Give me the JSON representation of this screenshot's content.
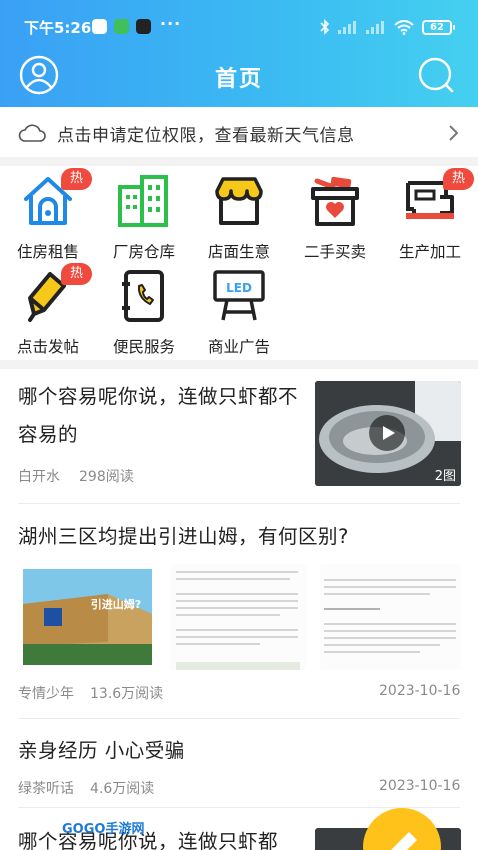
{
  "status": {
    "time": "下午5:26",
    "dots": "···",
    "battery": "62"
  },
  "nav": {
    "title": "首页",
    "left_icon": "user-icon",
    "right_icon": "search-icon"
  },
  "weather": {
    "text": "点击申请定位权限，查看最新天气信息",
    "icon": "cloud-icon"
  },
  "categories": [
    {
      "label": "住房租售",
      "hot": "热",
      "icon": "house-icon"
    },
    {
      "label": "厂房仓库",
      "icon": "building-icon"
    },
    {
      "label": "店面生意",
      "icon": "store-icon"
    },
    {
      "label": "二手买卖",
      "icon": "gift-box-icon"
    },
    {
      "label": "生产加工",
      "hot": "热",
      "icon": "sewing-machine-icon"
    },
    {
      "label": "点击发帖",
      "hot": "热",
      "icon": "pencil-icon"
    },
    {
      "label": "便民服务",
      "icon": "phone-book-icon"
    },
    {
      "label": "商业广告",
      "icon": "led-sign-icon",
      "sign_text": "LED"
    }
  ],
  "articles": [
    {
      "title_line1": "哪个容易呢你说，连做只虾都不",
      "title_line2": "容易的",
      "author": "白开水",
      "reads": "298阅读",
      "image_count": "2图"
    },
    {
      "title": "湖州三区均提出引进山姆，有何区别?",
      "author": "专情少年",
      "reads": "13.6万阅读",
      "date": "2023-10-16",
      "img1_caption": "引进山姆?"
    },
    {
      "title": "亲身经历 小心受骗",
      "author": "绿茶听话",
      "reads": "4.6万阅读",
      "date": "2023-10-16"
    },
    {
      "title_partial": "哪个容易呢你说，连做只虾都"
    }
  ],
  "watermark": "GOGO手游网",
  "colors": {
    "header_start": "#3aa0f5",
    "header_end": "#45d0f0",
    "hot_badge": "#ef4a3d",
    "fab": "#ffc21a",
    "icon_blue": "#1e8ae6",
    "icon_green": "#2cc04a",
    "icon_yellow": "#f5c81a",
    "icon_red": "#e84a3c"
  }
}
